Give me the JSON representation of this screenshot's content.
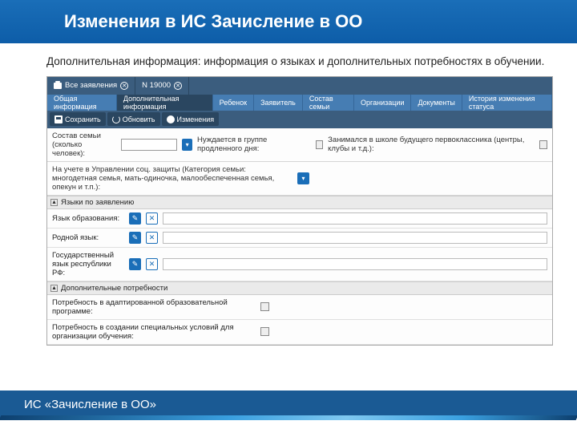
{
  "slide": {
    "title": "Изменения в ИС Зачисление в ОО",
    "subtitle": "Дополнительная информация: информация о языках и дополнительных потребностях в обучении.",
    "footer": "ИС «Зачисление в ОО»"
  },
  "appTabs": [
    {
      "label": "Все заявления"
    },
    {
      "label": "N 19000"
    }
  ],
  "subTabs": [
    "Общая информация",
    "Дополнительная информация",
    "Ребенок",
    "Заявитель",
    "Состав семьи",
    "Организации",
    "Документы",
    "История изменения статуса"
  ],
  "toolbar": {
    "save": "Сохранить",
    "refresh": "Обновить",
    "changes": "Изменения"
  },
  "family": {
    "label": "Состав семьи (сколько человек):",
    "extDayLabel": "Нуждается в группе продленного дня:",
    "futureLabel": "Занимался в школе будущего первоклассника (центры, клубы и т.д.):"
  },
  "socLabel": "На учете в Управлении соц. защиты (Категория семьи: многодетная семья, мать-одиночка, малообеспеченная семья, опекун и т.п.):",
  "sections": {
    "lang": "Языки по заявлению",
    "needs": "Дополнительные потребности"
  },
  "langRows": [
    {
      "label": "Язык образования:"
    },
    {
      "label": "Родной язык:"
    },
    {
      "label": "Государственный язык республики РФ:"
    }
  ],
  "needRows": [
    {
      "label": "Потребность в адаптированной образовательной программе:"
    },
    {
      "label": "Потребность в создании специальных условий для организации обучения:"
    }
  ]
}
